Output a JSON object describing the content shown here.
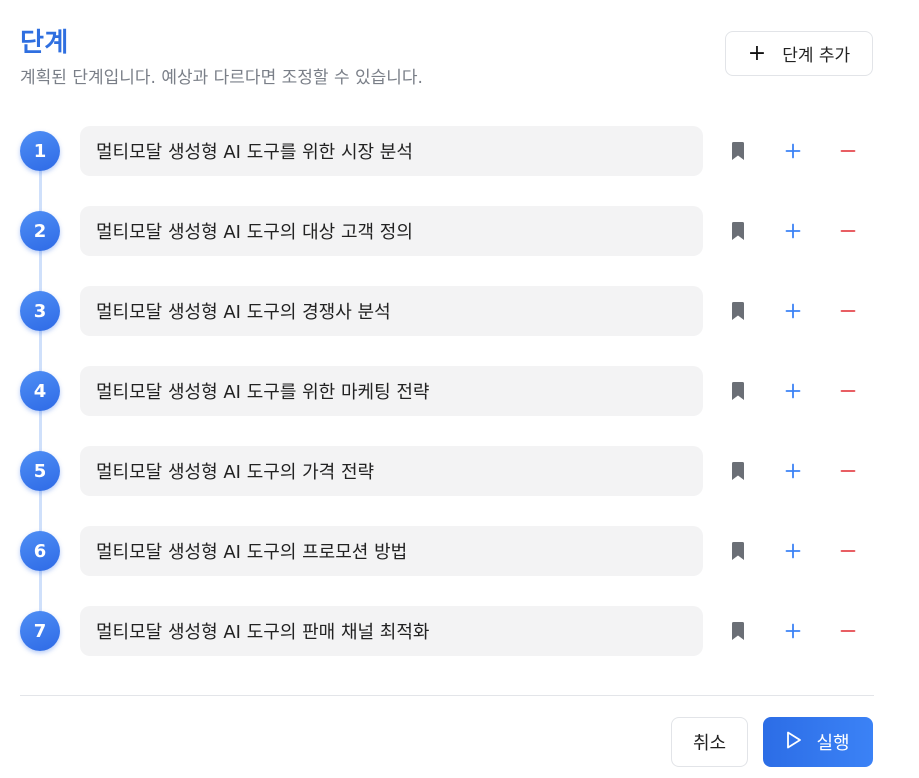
{
  "header": {
    "title": "단계",
    "subtitle": "계획된 단계입니다. 예상과 다르다면 조정할 수 있습니다.",
    "add_step_label": "단계 추가"
  },
  "steps": [
    {
      "number": "1",
      "text": "멀티모달 생성형 AI 도구를 위한 시장 분석"
    },
    {
      "number": "2",
      "text": "멀티모달 생성형 AI 도구의 대상 고객 정의"
    },
    {
      "number": "3",
      "text": "멀티모달 생성형 AI 도구의 경쟁사 분석"
    },
    {
      "number": "4",
      "text": "멀티모달 생성형 AI 도구를 위한 마케팅 전략"
    },
    {
      "number": "5",
      "text": "멀티모달 생성형 AI 도구의 가격 전략"
    },
    {
      "number": "6",
      "text": "멀티모달 생성형 AI 도구의 프로모션 방법"
    },
    {
      "number": "7",
      "text": "멀티모달 생성형 AI 도구의 판매 채널 최적화"
    }
  ],
  "footer": {
    "cancel_label": "취소",
    "run_label": "실행"
  },
  "colors": {
    "accent": "#2f6fe0",
    "plus": "#3b82f6",
    "minus": "#e5484d",
    "bookmark": "#6b6f76"
  },
  "icons": {
    "row_actions": [
      "bookmark-icon",
      "plus-icon",
      "minus-icon"
    ],
    "run": "play-icon"
  }
}
